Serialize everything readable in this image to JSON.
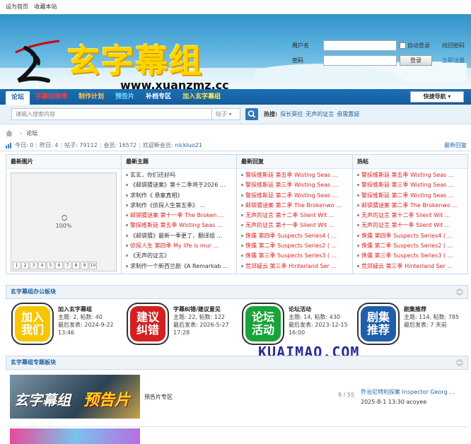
{
  "topbar": {
    "set_home": "设为首页",
    "bookmark": "收藏本站"
  },
  "logo": {
    "text": "玄字幕组",
    "url": "www.xuanzmz.cc"
  },
  "login": {
    "username_label": "用户名",
    "password_label": "密码",
    "auto_login": "自动登录",
    "find_password": "找回密码",
    "register": "立即注册",
    "submit": "登录"
  },
  "nav": {
    "items": [
      "论坛",
      "字幕组微博",
      "制作计划",
      "预告片",
      "补档专区",
      "加入玄字幕组"
    ],
    "colors": [
      "#1a5f9e",
      "#ff3b3b",
      "#ffc54a",
      "#6ee3ff",
      "#ffffff",
      "#ffe64a"
    ],
    "quick": "快捷导航"
  },
  "search": {
    "placeholder": "请输入搜索内容",
    "type": "帖子",
    "hot_label": "热搜:",
    "hot": [
      "探长葵拉",
      "无声的证言",
      "毋需置疑"
    ]
  },
  "breadcrumb": {
    "current": "论坛"
  },
  "stats": {
    "today_label": "今日:",
    "today": "0",
    "yesterday_label": "昨日:",
    "yesterday": "4",
    "posts_label": "帖子:",
    "posts": "79112",
    "members_label": "会员:",
    "members": "16572",
    "welcome_label": "欢迎新会员:",
    "new_member": "nickluo21",
    "latest_reply": "最新回复"
  },
  "latest_images": {
    "title": "最新图片",
    "loading": "100%",
    "pages": [
      "1",
      "2",
      "3",
      "4",
      "5",
      "6",
      "7",
      "8",
      "9",
      "10"
    ]
  },
  "latest_topics": {
    "title": "最新主题",
    "items": [
      {
        "text": "玄玄，你们还好吗",
        "color": "#333"
      },
      {
        "text": "《邮袋猜谜案》第十二季将于2026 ...",
        "color": "#333"
      },
      {
        "text": "求制作《 悬案真相》",
        "color": "#333"
      },
      {
        "text": "求制作《侦探人生第五季》 ...",
        "color": "#333"
      },
      {
        "text": "邮袋猜谜案 第十一季 The Broken ...",
        "color": "#d22"
      },
      {
        "text": "警探维斯廷 第五季 Wisting Seas ...",
        "color": "#d22"
      },
      {
        "text": "《邮袋猜》最新一季更了，翻译组 ...",
        "color": "#333"
      },
      {
        "text": "侦探人生 第四季 My life is mur ...",
        "color": "#d22"
      },
      {
        "text": "《无声的证言》",
        "color": "#333"
      },
      {
        "text": "求制作一个新西兰剧《A Remarkab ...",
        "color": "#333"
      }
    ]
  },
  "latest_replies": {
    "title": "最新回复",
    "items": [
      {
        "text": "警探维斯廷 第五季 Wisting Seas ...",
        "color": "#d22"
      },
      {
        "text": "警探维斯廷 第三季 Wisting Seas ...",
        "color": "#d22"
      },
      {
        "text": "警探维斯廷 第二季 Wisting Seas ...",
        "color": "#d22"
      },
      {
        "text": "邮袋猜谜案 第二季 The Brokenwo ...",
        "color": "#d22"
      },
      {
        "text": "无声的证言 第十二季 Silent Wit ...",
        "color": "#d22"
      },
      {
        "text": "无声的证言 第十一季 Silent Wit ...",
        "color": "#d22"
      },
      {
        "text": "侏儒 第四季 Suspects Series4 ( ...",
        "color": "#d22"
      },
      {
        "text": "侏儒 第二季 Suspects Series2 ( ...",
        "color": "#d22"
      },
      {
        "text": "侏儒 第三季 Suspects Series3 ( ...",
        "color": "#d22"
      },
      {
        "text": "荒郊疑云 第三季 Hinterland Ser ...",
        "color": "#d22"
      }
    ]
  },
  "hot_threads": {
    "title": "热帖",
    "items": [
      {
        "text": "警探维斯廷 第五季 Wisting Seas ...",
        "color": "#d22"
      },
      {
        "text": "警探维斯廷 第三季 Wisting Seas ...",
        "color": "#d22"
      },
      {
        "text": "警探维斯廷 第二季 Wisting Seas ...",
        "color": "#d22"
      },
      {
        "text": "邮袋猜谜案 第二季 The Brokenwo ...",
        "color": "#d22"
      },
      {
        "text": "无声的证言 第十二季 Silent Wit ...",
        "color": "#d22"
      },
      {
        "text": "无声的证言 第十一季 Silent Wit ...",
        "color": "#d22"
      },
      {
        "text": "侏儒 第四季 Suspects Series4 ( ...",
        "color": "#d22"
      },
      {
        "text": "侏儒 第二季 Suspects Series2 ( ...",
        "color": "#d22"
      },
      {
        "text": "侏儒 第三季 Suspects Series3 ( ...",
        "color": "#d22"
      },
      {
        "text": "荒郊疑云 第三季 Hinterland Ser ...",
        "color": "#d22"
      }
    ]
  },
  "office_section": {
    "title": "玄字幕组办公板块",
    "boards": [
      {
        "icon_text": "加入我们",
        "icon_color": "#f7c600",
        "name": "加入玄字幕组",
        "topics": "主题: 2, 帖数: 40",
        "last": "最后发表: 2024-9-22",
        "last2": "13:46"
      },
      {
        "icon_text": "建议纠错",
        "icon_color": "#d42020",
        "name": "字幕纠错/建议意见",
        "topics": "主题: 22, 帖数: 122",
        "last": "最后发表: 2026-5-27",
        "last2": "17:28"
      },
      {
        "icon_text": "论坛活动",
        "icon_color": "#1aa33a",
        "name": "论坛活动",
        "topics": "主题: 14, 帖数: 430",
        "last": "最后发表: 2023-12-15",
        "last2": "16:00"
      },
      {
        "icon_text": "剧集推荐",
        "icon_color": "#1f5fa8",
        "name": "剧集推荐",
        "topics": "主题: 114, 帖数: 785",
        "last": "最后发表: 7 天前",
        "last2": ""
      }
    ]
  },
  "watermark": "KUAIMAO.COM",
  "special_section": {
    "title": "玄字幕组专题板块",
    "thumb_text": "玄字幕组",
    "thumb_text2": "预告片",
    "name": "预告片专区",
    "count_a": "8",
    "count_sep": " / ",
    "count_b": "55",
    "last_title": "乔治尼特利探案 Inspector Georg ...",
    "last_time": "2025-8-1 13:30",
    "last_user": "acoyee"
  }
}
